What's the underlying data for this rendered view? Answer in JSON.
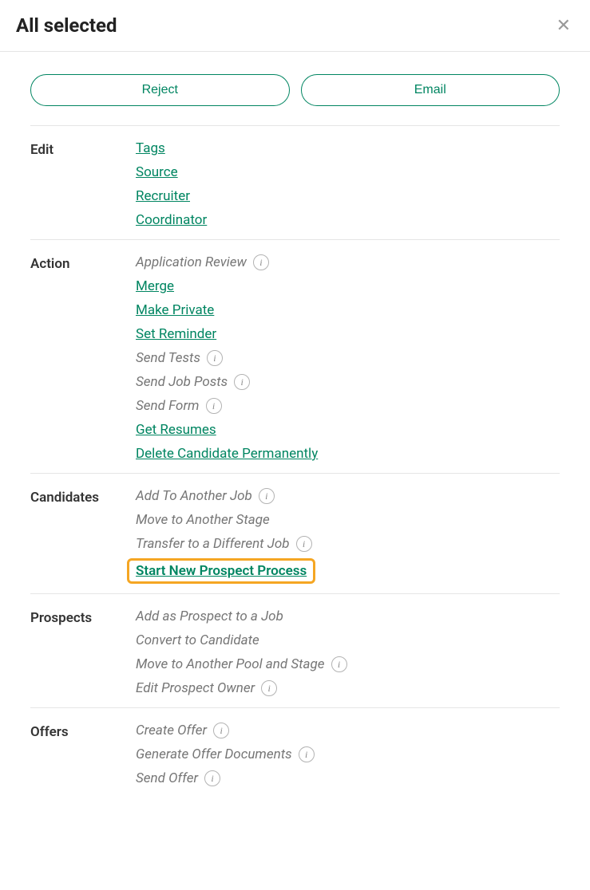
{
  "header": {
    "title": "All selected"
  },
  "buttons": {
    "reject": "Reject",
    "email": "Email"
  },
  "sections": {
    "edit": {
      "label": "Edit",
      "tags": "Tags",
      "source": "Source",
      "recruiter": "Recruiter",
      "coordinator": "Coordinator"
    },
    "action": {
      "label": "Action",
      "application_review": "Application Review",
      "merge": "Merge",
      "make_private": "Make Private",
      "set_reminder": "Set Reminder",
      "send_tests": "Send Tests",
      "send_job_posts": "Send Job Posts",
      "send_form": "Send Form",
      "get_resumes": "Get Resumes",
      "delete_candidate": "Delete Candidate Permanently"
    },
    "candidates": {
      "label": "Candidates",
      "add_to_another_job": "Add To Another Job",
      "move_to_another_stage": "Move to Another Stage",
      "transfer_to_different_job": "Transfer to a Different Job",
      "start_new_prospect_process": "Start New Prospect Process"
    },
    "prospects": {
      "label": "Prospects",
      "add_as_prospect": "Add as Prospect to a Job",
      "convert_to_candidate": "Convert to Candidate",
      "move_to_another_pool": "Move to Another Pool and Stage",
      "edit_prospect_owner": "Edit Prospect Owner"
    },
    "offers": {
      "label": "Offers",
      "create_offer": "Create Offer",
      "generate_offer_documents": "Generate Offer Documents",
      "send_offer": "Send Offer"
    }
  }
}
